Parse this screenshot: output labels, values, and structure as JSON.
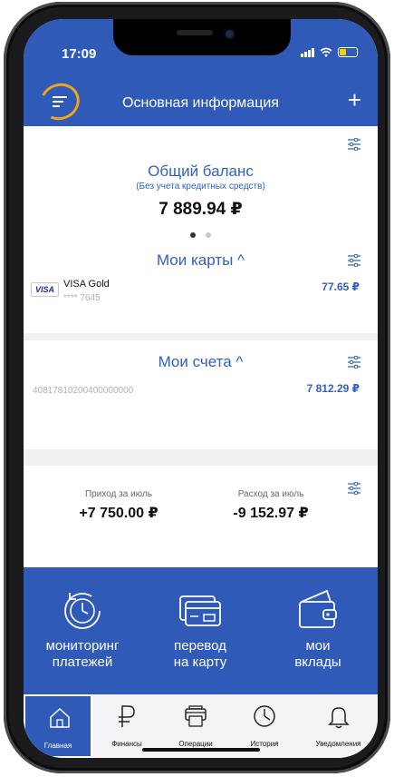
{
  "status_bar": {
    "time": "17:09"
  },
  "header": {
    "title": "Основная информация",
    "plus": "+"
  },
  "balance": {
    "title": "Общий баланс",
    "subtitle": "(Без учета кредитных средств)",
    "amount": "7 889.94 ₽",
    "pager_active": 0
  },
  "cards": {
    "title": "Мои карты ^",
    "items": [
      {
        "brand": "VISA",
        "name": "VISA Gold",
        "number": "**** 7645",
        "amount": "77.65 ₽"
      }
    ]
  },
  "accounts": {
    "title": "Мои счета ^",
    "items": [
      {
        "number": "40817810200400000000",
        "amount": "7 812.29 ₽"
      }
    ]
  },
  "summary": {
    "income_label": "Приход за июль",
    "income_value": "+7 750.00 ₽",
    "expense_label": "Расход за июль",
    "expense_value": "-9 152.97 ₽"
  },
  "quick_actions": [
    {
      "label_line1": "мониторинг",
      "label_line2": "платежей",
      "icon": "clock-refresh-icon"
    },
    {
      "label_line1": "перевод",
      "label_line2": "на карту",
      "icon": "card-transfer-icon"
    },
    {
      "label_line1": "мои",
      "label_line2": "вклады",
      "icon": "wallet-icon"
    }
  ],
  "tabs": [
    {
      "label": "Главная",
      "icon": "home-icon",
      "active": true
    },
    {
      "label": "Финансы",
      "icon": "ruble-icon",
      "active": false
    },
    {
      "label": "Операции",
      "icon": "printer-icon",
      "active": false
    },
    {
      "label": "История",
      "icon": "history-clock-icon",
      "active": false
    },
    {
      "label": "Уведомления",
      "icon": "bell-icon",
      "active": false
    }
  ],
  "colors": {
    "brand": "#2f5ab8",
    "link": "#3061be",
    "highlight": "#f0a31c"
  }
}
